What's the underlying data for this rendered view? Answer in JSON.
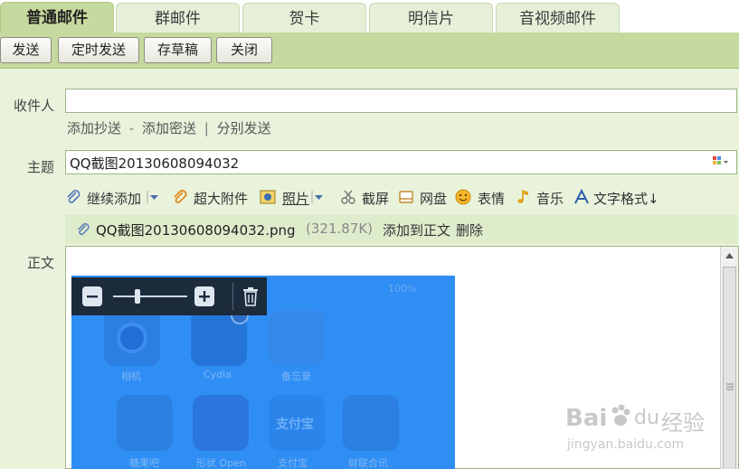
{
  "tabs": [
    {
      "label": "普通邮件",
      "active": true
    },
    {
      "label": "群邮件",
      "active": false
    },
    {
      "label": "贺卡",
      "active": false
    },
    {
      "label": "明信片",
      "active": false
    },
    {
      "label": "音视频邮件",
      "active": false
    }
  ],
  "toolbar": {
    "send": "发送",
    "timed_send": "定时发送",
    "save_draft": "存草稿",
    "close": "关闭"
  },
  "form": {
    "recipient_label": "收件人",
    "recipient_value": "",
    "add_cc": "添加抄送",
    "dash": "-",
    "add_bcc": "添加密送",
    "pipe": "|",
    "separate_send": "分别发送",
    "subject_label": "主题",
    "subject_value": "QQ截图20130608094032",
    "body_label": "正文"
  },
  "attach_toolbar": {
    "continue_add": "继续添加",
    "large_attachment": "超大附件",
    "photo": "照片",
    "screenshot": "截屏",
    "netdisk": "网盘",
    "emoji": "表情",
    "music": "音乐",
    "text_format": "文字格式↓"
  },
  "attachment": {
    "filename": "QQ截图20130608094032.png",
    "size": "(321.87K)",
    "add_to_body": "添加到正文",
    "delete": "删除"
  },
  "embedded_image": {
    "status": "100%",
    "apps": [
      "相机",
      "Cydia",
      "备忘录",
      "糖果吧",
      "形状 Open",
      "支付宝",
      "财联合讯"
    ],
    "alipay_icon_text": "支付宝"
  },
  "watermark": {
    "brand": "Bai",
    "brand2": "du",
    "brand3": "经验",
    "url": "jingyan.baidu.com"
  },
  "colors": {
    "tab_active": "#c6d99e",
    "toolbar_bg": "#c6d99e",
    "page_bg": "#e9f3dc",
    "image_blue": "#2f8ef4"
  }
}
